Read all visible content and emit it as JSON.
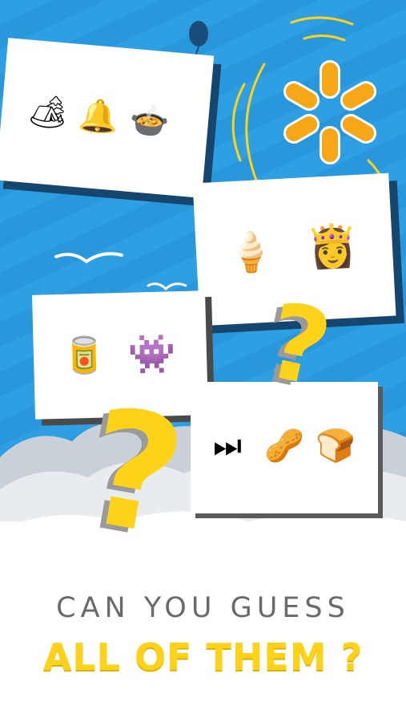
{
  "headline": {
    "line1": "CAN YOU GUESS",
    "line2": "ALL OF THEM ?"
  },
  "cards": [
    {
      "icons": [
        {
          "name": "camping-icon",
          "glyph": "🏕"
        },
        {
          "name": "bell-icon",
          "glyph": "🔔"
        },
        {
          "name": "stew-pot-icon",
          "glyph": "🍲"
        }
      ]
    },
    {
      "icons": [
        {
          "name": "ice-cream-cone-icon",
          "glyph": "🍦"
        },
        {
          "name": "princess-icon",
          "glyph": "👸"
        }
      ]
    },
    {
      "icons": [
        {
          "name": "black-can-icon",
          "glyph": "🥫"
        },
        {
          "name": "green-monster-icon",
          "glyph": "👾"
        }
      ]
    },
    {
      "icons": [
        {
          "name": "fast-forward-icon",
          "glyph": "⏭"
        },
        {
          "name": "peanuts-icon",
          "glyph": "🥜"
        },
        {
          "name": "bread-loaf-icon",
          "glyph": "🍞"
        }
      ]
    }
  ],
  "decor": {
    "question_mark": "?",
    "colors": {
      "sky": "#2e9fe3",
      "accent_yellow": "#ffd21a",
      "card_shadow": "#16456e",
      "headline_gray": "#6a6a6a"
    }
  }
}
